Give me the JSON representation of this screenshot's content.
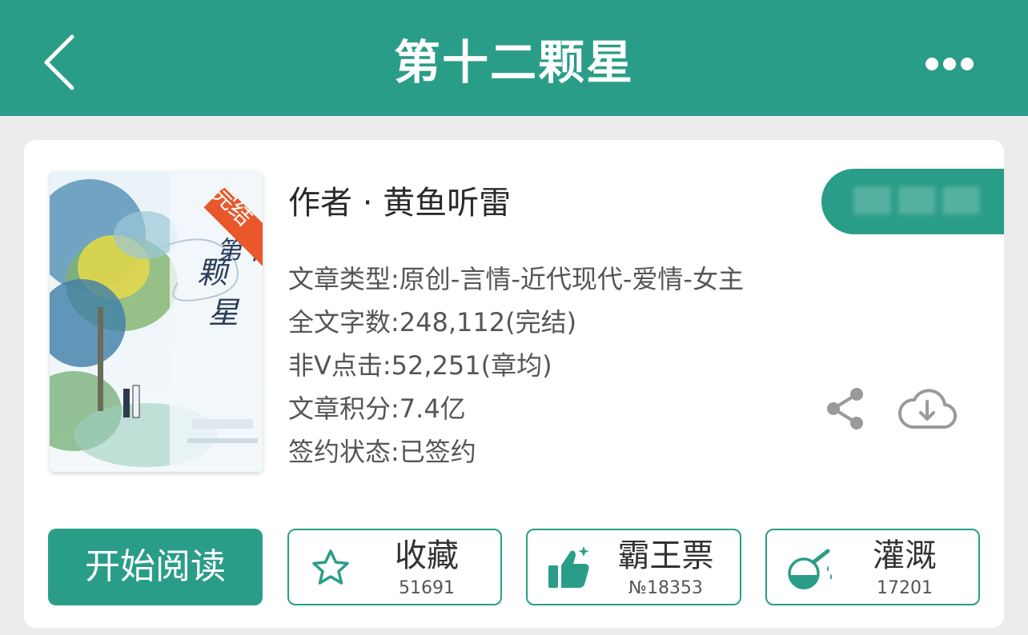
{
  "header": {
    "title": "第十二颗星",
    "back_icon": "chevron-left-icon",
    "more_icon": "more-horizontal-icon",
    "bg_color": "#2a9d88"
  },
  "book": {
    "badge": "完结",
    "cover_title": "第十二颗星",
    "author": "作者 · 黄鱼听雷",
    "info": [
      "文章类型:原创-言情-近代现代-爱情-女主",
      "全文字数:248,112(完结)",
      "非Ⅴ点击:52,251(章均)",
      "文章积分:7.4亿",
      "签约状态:已签约"
    ]
  },
  "icons": {
    "share": "share-icon",
    "download": "cloud-download-icon"
  },
  "actions": {
    "read_label": "开始阅读",
    "favorite": {
      "label": "收藏",
      "count": "51691",
      "icon": "star-icon"
    },
    "vote": {
      "label": "霸王票",
      "count": "№18353",
      "icon": "thumbs-up-icon"
    },
    "water": {
      "label": "灌溉",
      "count": "17201",
      "icon": "watering-flask-icon"
    }
  },
  "accent_color": "#2a9d88"
}
